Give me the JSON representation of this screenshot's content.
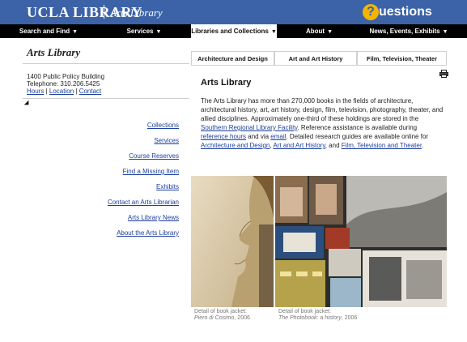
{
  "header": {
    "brand": "UCLA LIBRARY",
    "sub": "Arts Library",
    "questions_badge": "?",
    "questions_text": "uestions"
  },
  "nav": [
    {
      "label": "Search and Find"
    },
    {
      "label": "Services"
    },
    {
      "label": "Libraries and Collections"
    },
    {
      "label": "About"
    },
    {
      "label": "News, Events, Exhibits"
    }
  ],
  "left": {
    "title": "Arts Library",
    "address_line": "1400 Public Policy Building",
    "telephone_line": "Telephone: 310.206.5425",
    "hours": "Hours",
    "location": "Location",
    "contact": "Contact",
    "divider": "|",
    "links": [
      {
        "label": "Collections"
      },
      {
        "label": "Services"
      },
      {
        "label": "Course Reserves"
      },
      {
        "label": "Find a Missing Item"
      },
      {
        "label": "Exhibits"
      },
      {
        "label": "Contact an Arts Librarian"
      },
      {
        "label": "Arts Library News"
      },
      {
        "label": "About the Arts Library"
      }
    ]
  },
  "subtabs": [
    {
      "label": "Architecture and Design"
    },
    {
      "label": "Art and Art History"
    },
    {
      "label": "Film, Television, Theater"
    }
  ],
  "content": {
    "title": "Arts Library",
    "p1": "The Arts Library has more than 270,000 books in the fields of architecture, architectural history, art, art history, design, film, television, photography, theater, and allied disciplines. Approximately one-third of these holdings are stored in the ",
    "srlf": "Southern Regional Library Facility",
    "p2": ". Reference assistance is available during ",
    "ref_hours": "reference hours",
    "p3": " and via ",
    "email": "email",
    "p4": ". Detailed research guides are available online for ",
    "ad": "Architecture and Design",
    "p5": ", ",
    "aah": "Art and Art History",
    "p6": ", and ",
    "ftt": "Film, Television and Theater",
    "p7": "."
  },
  "captions": [
    {
      "prefix": "Detail of book jacket:",
      "title": "Piero di Cosimo",
      "year": ", 2006"
    },
    {
      "prefix": "Detail of book jacket:",
      "title": "The Photobook: a history",
      "year": ", 2006"
    }
  ],
  "icons": {
    "print": "printer-icon",
    "caret": "caret-down-icon"
  },
  "colors": {
    "header_bg": "#3c63a8",
    "nav_bg": "#000000",
    "link": "#1b3fa0",
    "accent": "#f4b400"
  }
}
